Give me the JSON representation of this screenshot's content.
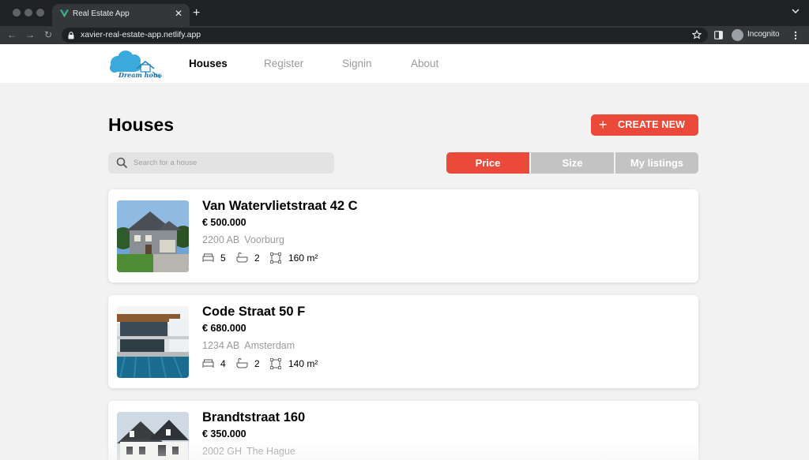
{
  "browser": {
    "tab_title": "Real Estate App",
    "url": "xavier-real-estate-app.netlify.app",
    "incognito_label": "Incognito",
    "icons": {
      "back": "arrow-left-icon",
      "forward": "arrow-right-icon",
      "reload": "reload-icon",
      "lock": "lock-icon",
      "star": "star-icon",
      "menu": "kebab-menu-icon"
    }
  },
  "header": {
    "logo_text": "Dream house",
    "nav": [
      {
        "label": "Houses",
        "active": true
      },
      {
        "label": "Register",
        "active": false
      },
      {
        "label": "Signin",
        "active": false
      },
      {
        "label": "About",
        "active": false
      }
    ]
  },
  "page": {
    "title": "Houses",
    "create_button": {
      "plus": "+",
      "label": "CREATE NEW"
    },
    "search": {
      "placeholder": "Search for a house",
      "value": ""
    },
    "sort": {
      "options": [
        "Price",
        "Size",
        "My listings"
      ],
      "active": "Price"
    }
  },
  "listings": [
    {
      "address": "Van Watervlietstraat 42 C",
      "price": "€ 500.000",
      "zip": "2200 AB",
      "city": "Voorburg",
      "bedrooms": "5",
      "bathrooms": "2",
      "size": "160 m²"
    },
    {
      "address": "Code Straat 50 F",
      "price": "€ 680.000",
      "zip": "1234 AB",
      "city": "Amsterdam",
      "bedrooms": "4",
      "bathrooms": "2",
      "size": "140 m²"
    },
    {
      "address": "Brandtstraat 160",
      "price": "€ 350.000",
      "zip": "2002 GH",
      "city": "The Hague"
    }
  ],
  "colors": {
    "accent": "#eb4a3a",
    "inactive_sort": "#c3c3c3",
    "background": "#f2f2f2",
    "muted_text": "#9a9a9a"
  }
}
